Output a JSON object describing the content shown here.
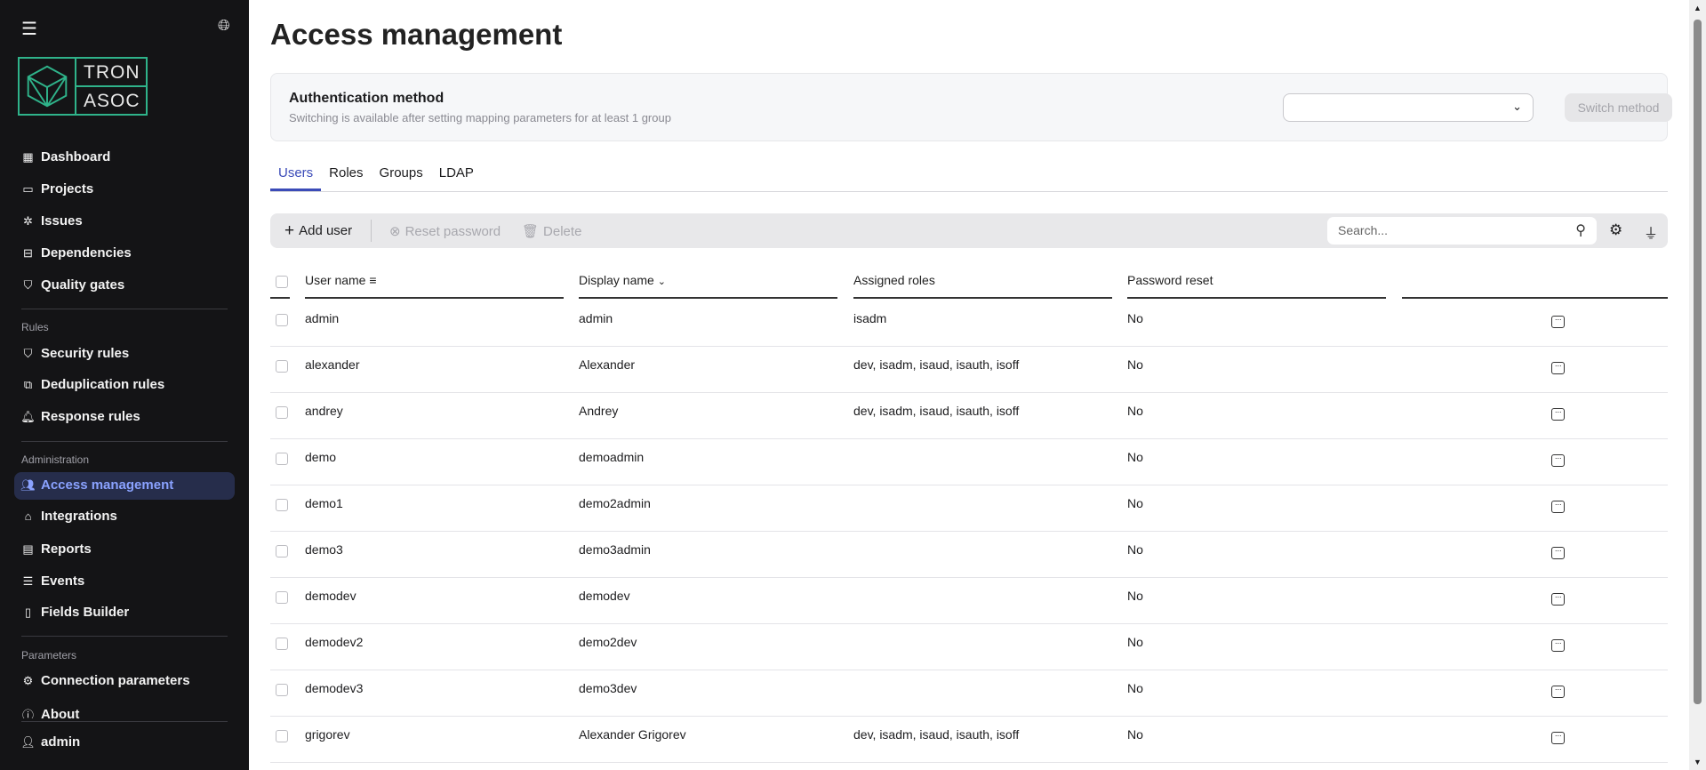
{
  "sidebar": {
    "logo": {
      "line1": "TRON",
      "line2": "ASOC"
    },
    "items_main": [
      {
        "label": "Dashboard",
        "icon": "grid-icon"
      },
      {
        "label": "Projects",
        "icon": "folder-icon"
      },
      {
        "label": "Issues",
        "icon": "bug-icon"
      },
      {
        "label": "Dependencies",
        "icon": "book-icon"
      },
      {
        "label": "Quality gates",
        "icon": "shield-check-icon"
      }
    ],
    "section_rules": "Rules",
    "items_rules": [
      {
        "label": "Security rules"
      },
      {
        "label": "Deduplication rules"
      },
      {
        "label": "Response rules"
      }
    ],
    "section_admin": "Administration",
    "items_admin": [
      {
        "label": "Access management"
      },
      {
        "label": "Integrations"
      },
      {
        "label": "Reports"
      },
      {
        "label": "Events"
      },
      {
        "label": "Fields Builder"
      }
    ],
    "section_params": "Parameters",
    "items_params": [
      {
        "label": "Connection parameters"
      },
      {
        "label": "About"
      }
    ],
    "user": "admin"
  },
  "page": {
    "title": "Access management"
  },
  "auth": {
    "title": "Authentication method",
    "subtitle": "Switching is available after setting mapping parameters for at least 1 group",
    "select_value": "",
    "switch_label": "Switch method"
  },
  "tabs": [
    "Users",
    "Roles",
    "Groups",
    "LDAP"
  ],
  "toolbar": {
    "add": "Add user",
    "reset": "Reset password",
    "delete": "Delete",
    "search_placeholder": "Search..."
  },
  "table": {
    "headers": [
      "User name",
      "Display name",
      "Assigned roles",
      "Password reset"
    ],
    "rows": [
      [
        "admin",
        "admin",
        "isadm",
        "No"
      ],
      [
        "alexander",
        "Alexander",
        "dev, isadm, isaud, isauth, isoff",
        "No"
      ],
      [
        "andrey",
        "Andrey",
        "dev, isadm, isaud, isauth, isoff",
        "No"
      ],
      [
        "demo",
        "demoadmin",
        "",
        "No"
      ],
      [
        "demo1",
        "demo2admin",
        "",
        "No"
      ],
      [
        "demo3",
        "demo3admin",
        "",
        "No"
      ],
      [
        "demodev",
        "demodev",
        "",
        "No"
      ],
      [
        "demodev2",
        "demo2dev",
        "",
        "No"
      ],
      [
        "demodev3",
        "demo3dev",
        "",
        "No"
      ],
      [
        "grigorev",
        "Alexander Grigorev",
        "dev, isadm, isaud, isauth, isoff",
        "No"
      ]
    ]
  },
  "colors": {
    "accent": "#3b4bb8",
    "sidebar_bg": "#141416",
    "logo": "#2fb38a",
    "active_bg": "#262d4b",
    "active_text": "#8aa2ff"
  }
}
